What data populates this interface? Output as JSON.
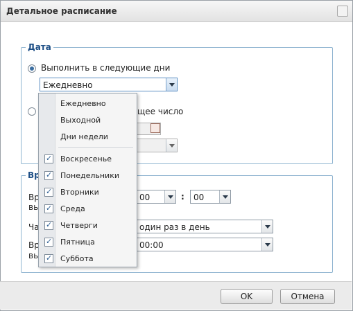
{
  "dialog": {
    "title": "Детальное расписание"
  },
  "date_section": {
    "legend": "Дата",
    "option_days_label": "Выполнить в следующие дни",
    "days_select_value": "Ежедневно",
    "option_date_label_partial": "щее число"
  },
  "time_section": {
    "legend_partial": "Вр",
    "row1_label_a": "Вр",
    "row1_label_b": "вы",
    "hour_value": "00",
    "colon": ":",
    "minute_value": "00",
    "row2_label": "Ча",
    "frequency_value": "один раз в день",
    "row3_label_a": "Вр",
    "row3_label_b": "вы",
    "last_time_value": "00:00"
  },
  "dropdown": {
    "presets": [
      "Ежедневно",
      "Выходной",
      "Дни недели"
    ],
    "days": [
      {
        "label": "Воскресенье",
        "checked": true
      },
      {
        "label": "Понедельники",
        "checked": true
      },
      {
        "label": "Вторники",
        "checked": true
      },
      {
        "label": "Среда",
        "checked": true
      },
      {
        "label": "Четверги",
        "checked": true
      },
      {
        "label": "Пятница",
        "checked": true
      },
      {
        "label": "Суббота",
        "checked": true
      }
    ]
  },
  "footer": {
    "ok_label": "OK",
    "cancel_label": "Отмена"
  }
}
